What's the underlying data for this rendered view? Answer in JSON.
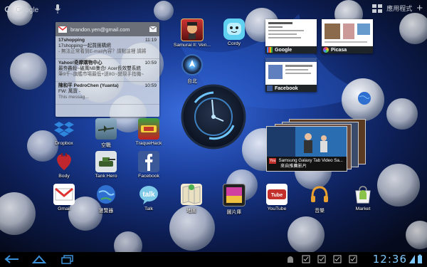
{
  "topbar": {
    "search_label": "Google",
    "apps_label": "應用程式"
  },
  "email": {
    "account": "brandon.yen@gmail.com",
    "messages": [
      {
        "from": "17shopping",
        "time": "11:19",
        "subject": "17shopping一起買團購網",
        "body": "- 無法正常看到E-mail內容？請點這裡 請將"
      },
      {
        "from": "Yahoo!奇摩購物中心",
        "time": "10:59",
        "subject": "最夯轟殺~破萬NB集合! Acer長效雙系統",
        "body": "筆9千~旗艦市場最低+送8G~變現手指機~"
      },
      {
        "from": "陳和平 PedroChen (Yuanta)",
        "time": "10:59",
        "subject": "FW: 萬寶 -",
        "body": "This messag..."
      }
    ]
  },
  "apps": {
    "samurai": "Samurai II: Ven...",
    "cordy": "Cordy",
    "widget_loc": "台北",
    "dropbox": "Dropbox",
    "airplane": "空戰",
    "traquehack": "TraqueHack",
    "body": "Body",
    "tankhero": "Tank Hero",
    "facebook": "Facebook",
    "gmail": "Gmail",
    "browser": "瀏覽器",
    "talk": "Talk",
    "maps": "地圖",
    "gallery": "圖片庫",
    "youtube": "YouTube",
    "music": "音樂",
    "market": "Market"
  },
  "thumbs": {
    "google": "Google",
    "picasa": "Picasa",
    "facebook": "Facebook"
  },
  "youtube_widget": {
    "title": "Samsung Galaxy Tab Video Sa...",
    "subtitle": "來自推薦影片"
  },
  "status": {
    "clock": "12:36"
  },
  "colors": {
    "accent_blue": "#7ec9ff",
    "navbar_icon": "#3a8fd6"
  }
}
